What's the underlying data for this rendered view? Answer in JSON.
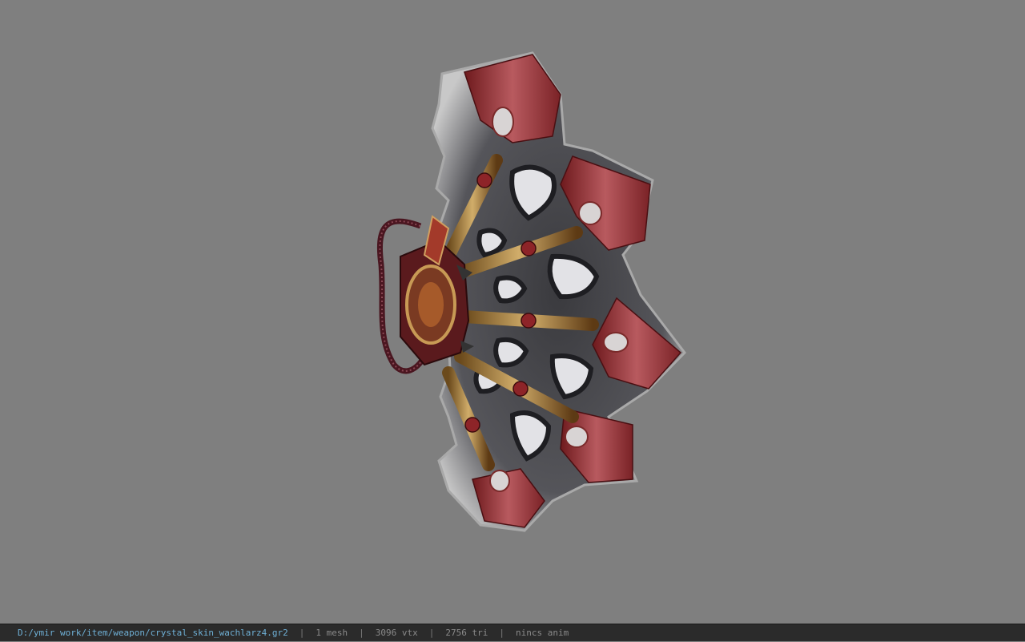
{
  "viewer": {
    "background_color": "#7f7f7f",
    "model_name": "crystal_skin_wachlarz4"
  },
  "statusbar": {
    "path": "D:/ymir work/item/weapon/crystal_skin_wachlarz4.gr2",
    "separator": "|",
    "mesh_count": "1 mesh",
    "vertex_count": "3096 vtx",
    "triangle_count": "2756 tri",
    "anim_status": "nincs anim",
    "path_color": "#6fb0d6",
    "text_color": "#8a8a8a"
  }
}
